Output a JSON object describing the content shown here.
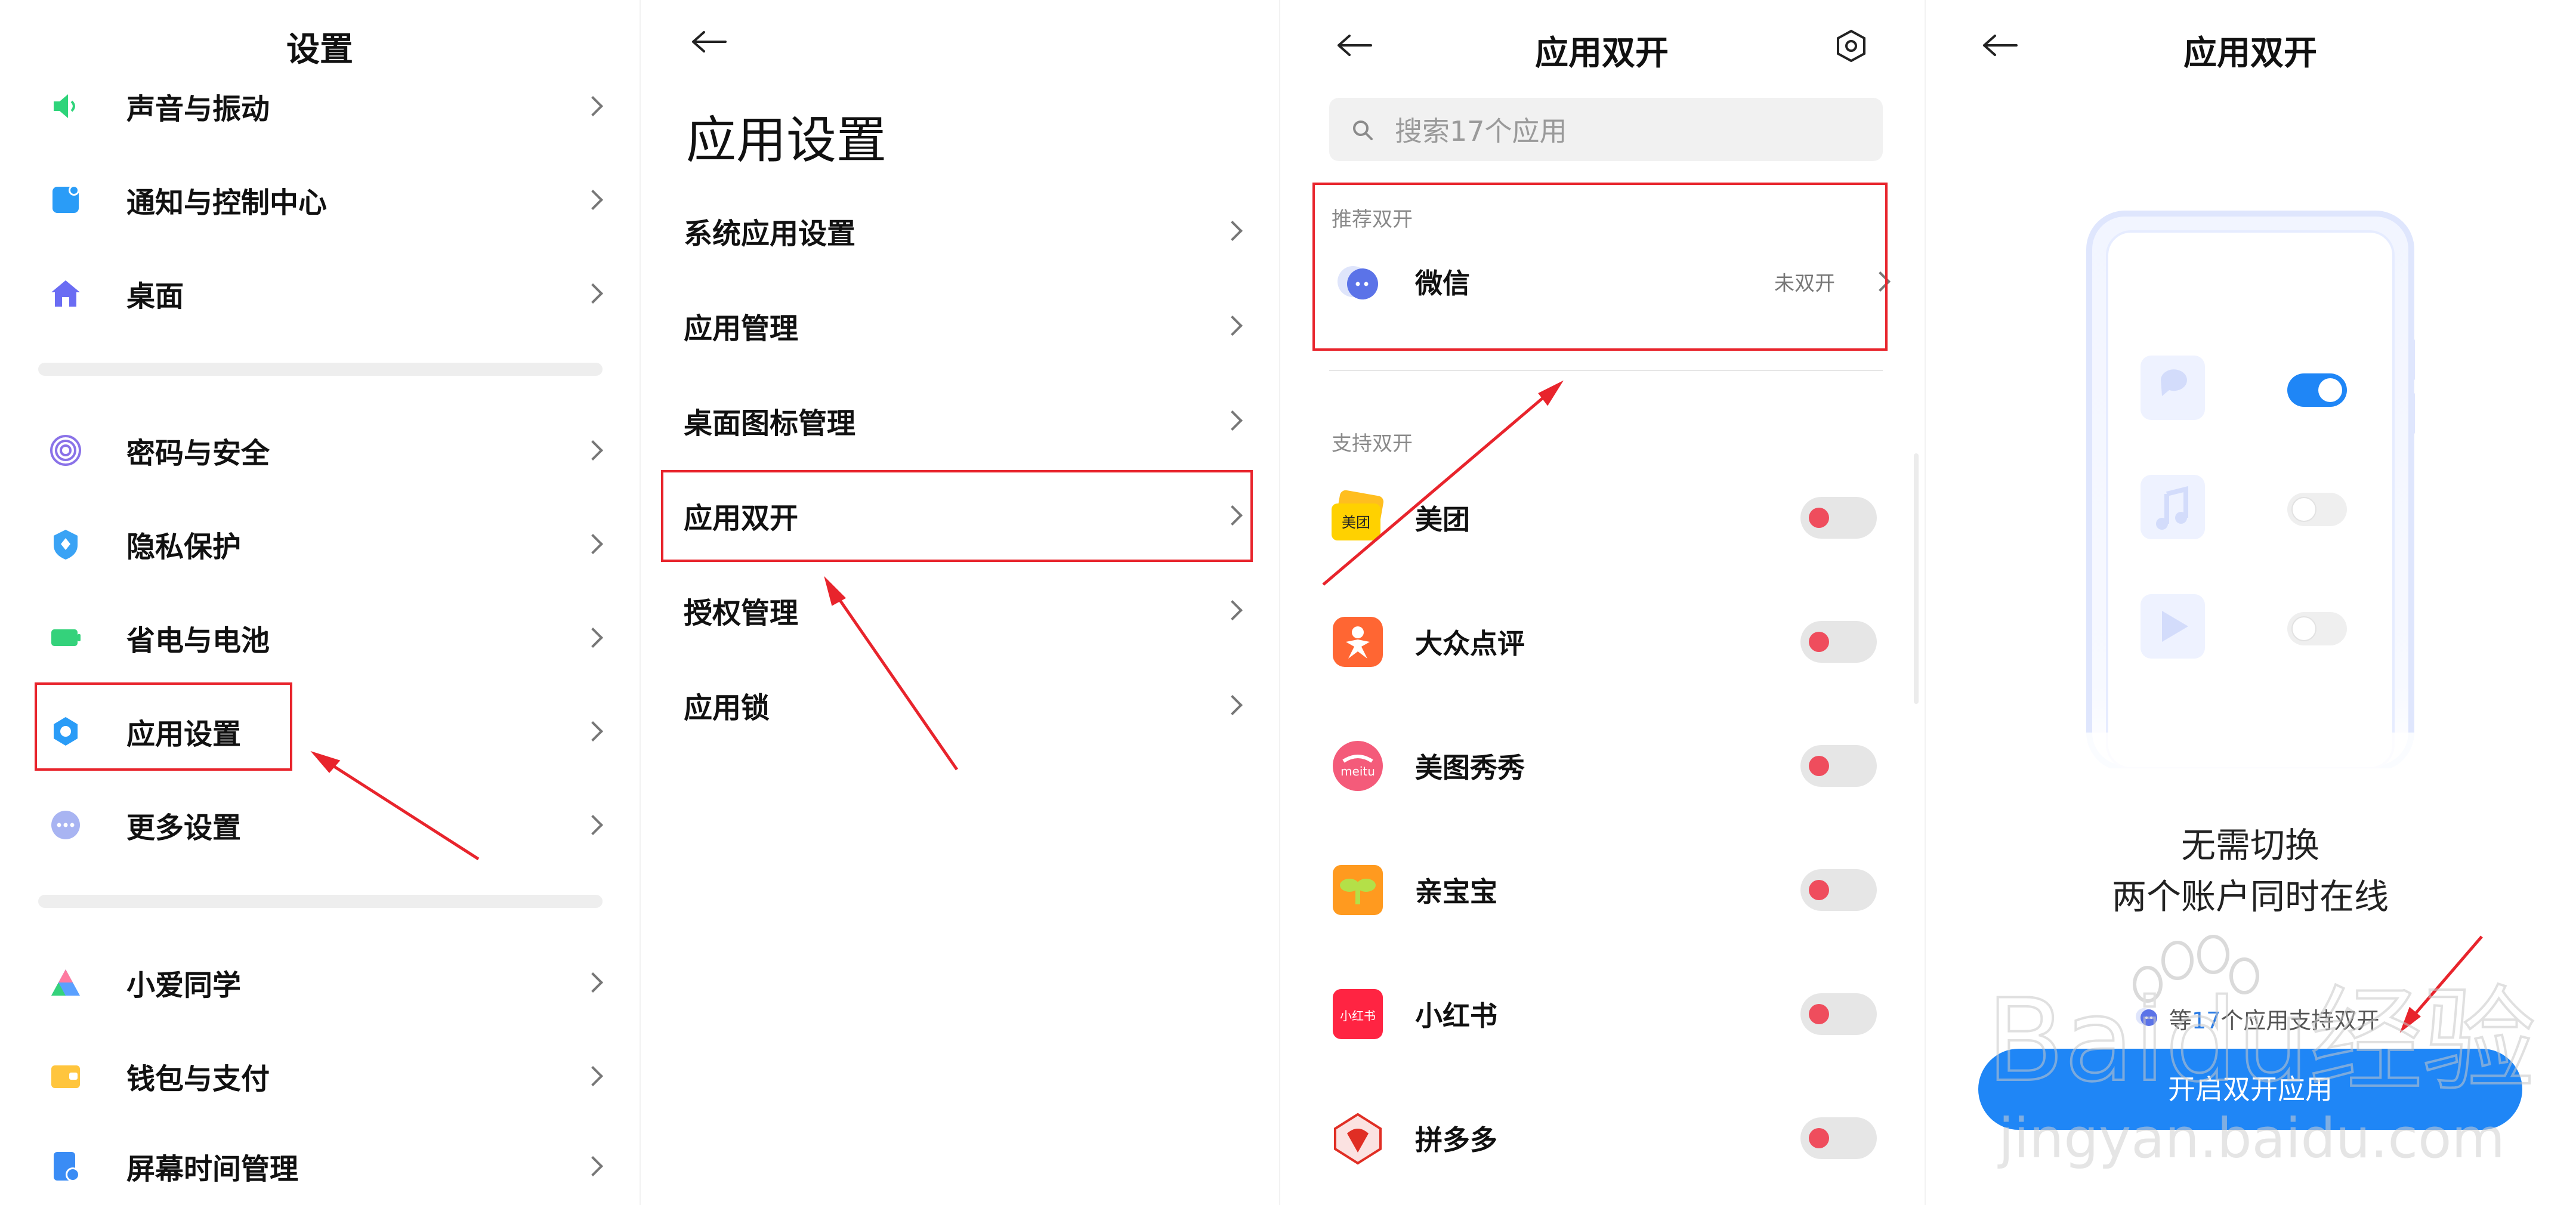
{
  "panel1": {
    "title": "设置",
    "items": [
      {
        "label": "声音与振动",
        "icon": "speaker-icon",
        "color": "#2ed47a"
      },
      {
        "label": "通知与控制中心",
        "icon": "notification-icon",
        "color": "#2a9cf7"
      },
      {
        "label": "桌面",
        "icon": "home-icon",
        "color": "#6a6cf3"
      },
      {
        "label": "密码与安全",
        "icon": "fingerprint-icon",
        "color": "#8a72e8"
      },
      {
        "label": "隐私保护",
        "icon": "shield-icon",
        "color": "#3aa3f5"
      },
      {
        "label": "省电与电池",
        "icon": "battery-icon",
        "color": "#34d27b"
      },
      {
        "label": "应用设置",
        "icon": "gear-icon",
        "color": "#2a9cf7"
      },
      {
        "label": "更多设置",
        "icon": "more-icon",
        "color": "#a8b4f2"
      },
      {
        "label": "小爱同学",
        "icon": "assistant-icon",
        "color": "#5aa0ff"
      },
      {
        "label": "钱包与支付",
        "icon": "wallet-icon",
        "color": "#ffc53d"
      },
      {
        "label": "屏幕时间管理",
        "icon": "screen-time-icon",
        "color": "#3a8cf5"
      }
    ]
  },
  "panel2": {
    "title": "应用设置",
    "items": [
      {
        "label": "系统应用设置"
      },
      {
        "label": "应用管理"
      },
      {
        "label": "桌面图标管理"
      },
      {
        "label": "应用双开"
      },
      {
        "label": "授权管理"
      },
      {
        "label": "应用锁"
      }
    ]
  },
  "panel3": {
    "title": "应用双开",
    "search_placeholder": "搜索17个应用",
    "recommended_label": "推荐双开",
    "recommended_app": {
      "label": "微信",
      "status": "未双开"
    },
    "supported_label": "支持双开",
    "apps": [
      {
        "label": "美团",
        "icon": "meituan-icon",
        "icon_text": "美团",
        "color": "#ffd100",
        "enabled": false
      },
      {
        "label": "大众点评",
        "icon": "dianping-icon",
        "color": "#ff6633",
        "enabled": false
      },
      {
        "label": "美图秀秀",
        "icon": "meitu-icon",
        "icon_text": "meitu",
        "color": "#f45b7a",
        "enabled": false
      },
      {
        "label": "亲宝宝",
        "icon": "qinbaobao-icon",
        "color": "#ff9a1f",
        "enabled": false
      },
      {
        "label": "小红书",
        "icon": "xiaohongshu-icon",
        "icon_text": "小红书",
        "color": "#ff2442",
        "enabled": false
      },
      {
        "label": "拼多多",
        "icon": "pinduoduo-icon",
        "color": "#e02e24",
        "enabled": false
      }
    ]
  },
  "panel4": {
    "title": "应用双开",
    "headline_line1": "无需切换",
    "headline_line2": "两个账户同时在线",
    "note_prefix": "等",
    "note_count": "17",
    "note_suffix": "个应用支持双开",
    "cta_label": "开启双开应用"
  },
  "watermark": {
    "line1": "Baidu经验",
    "line2": "jingyan.baidu.com"
  },
  "colors": {
    "accent": "#1f86f6",
    "annotation": "#e8242c",
    "toggle_knob": "#ef4d5d"
  }
}
